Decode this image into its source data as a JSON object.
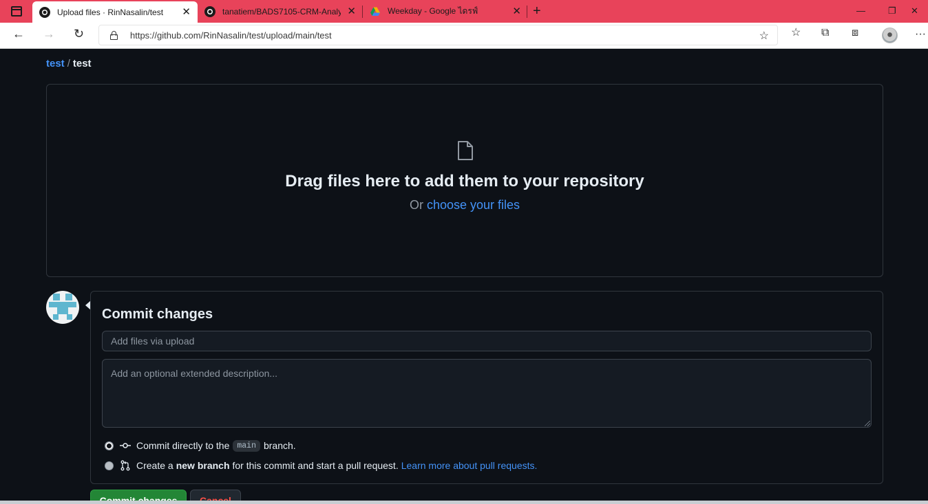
{
  "browser": {
    "tabs": [
      {
        "label": "Upload files · RinNasalin/test",
        "close": "✕"
      },
      {
        "label": "tanatiem/BADS7105-CRM-Analy",
        "close": "✕"
      },
      {
        "label": "Weekday - Google ไดรฟ์",
        "close": "✕"
      }
    ],
    "new_tab": "+",
    "window_controls": {
      "minimize": "—",
      "restore": "❐",
      "close": "✕"
    },
    "nav": {
      "back": "←",
      "forward": "→",
      "refresh": "↻"
    },
    "url": "https://github.com/RinNasalin/test/upload/main/test",
    "toolbar_icons": {
      "favorite_add": "☆",
      "favorites": "☆",
      "collections": "⧉",
      "extensions": "⧈",
      "more": "···"
    }
  },
  "breadcrumb": {
    "repo": "test",
    "separator": "/",
    "current": "test"
  },
  "dropzone": {
    "title": "Drag files here to add them to your repository",
    "prefix": "Or",
    "link": "choose your files"
  },
  "commit": {
    "title": "Commit changes",
    "summary_placeholder": "Add files via upload",
    "description_placeholder": "Add an optional extended description...",
    "option_direct": {
      "before": "Commit directly to the",
      "branch": "main",
      "after": "branch."
    },
    "option_new": {
      "before": "Create a",
      "bold": "new branch",
      "after": "for this commit and start a pull request.",
      "link": "Learn more about pull requests."
    },
    "commit_button": "Commit changes",
    "cancel_button": "Cancel"
  },
  "colors": {
    "tabbar": "#e8435a",
    "page_bg": "#0d1117",
    "link": "#4493f8",
    "primary_button": "#238636"
  }
}
